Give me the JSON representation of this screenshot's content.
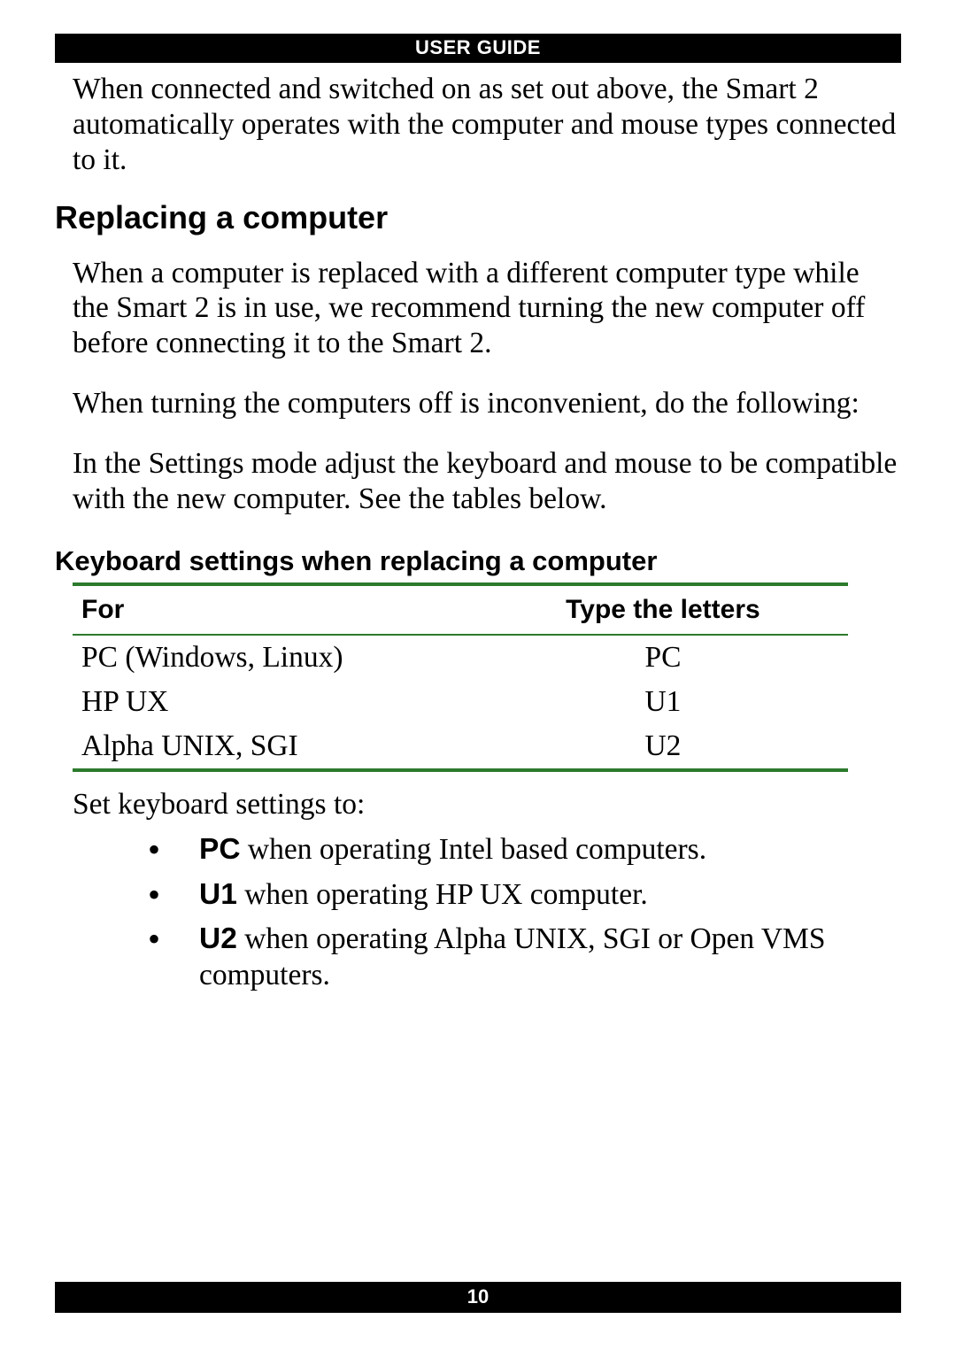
{
  "header": {
    "title": "USER GUIDE"
  },
  "intro": "When connected and switched on as set out above, the Smart 2 automatically operates with the computer and mouse types connected to it.",
  "section_heading": "Replacing a computer",
  "paras": [
    "When a computer is replaced with a different computer type while the Smart 2 is in use, we recommend turning the new computer off before connecting it to the Smart 2.",
    "When turning the computers off is inconvenient, do the following:",
    "In the Settings mode adjust the keyboard and mouse to be compatible with the new computer. See the tables below."
  ],
  "subsection": "Keyboard settings when replacing a computer",
  "table": {
    "headers": {
      "c1": "For",
      "c2": "Type the letters"
    },
    "rows": [
      {
        "c1": "PC (Windows, Linux)",
        "c2": "PC"
      },
      {
        "c1": "HP UX",
        "c2": "U1"
      },
      {
        "c1": "Alpha UNIX, SGI",
        "c2": "U2"
      }
    ]
  },
  "after_table": "Set keyboard settings to:",
  "bullets": [
    {
      "bold": "PC",
      "rest": " when operating Intel based computers."
    },
    {
      "bold": "U1",
      "rest": " when operating HP UX computer."
    },
    {
      "bold": "U2",
      "rest": " when operating Alpha UNIX, SGI or Open VMS computers."
    }
  ],
  "footer": {
    "page": "10"
  }
}
